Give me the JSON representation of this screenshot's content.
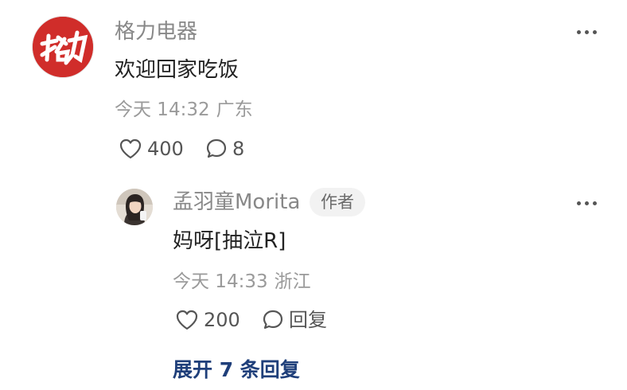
{
  "comment": {
    "author": "格力电器",
    "avatar_logo_text": "格力",
    "text": "欢迎回家吃饭",
    "time": "今天 14:32",
    "location": "广东",
    "like_count": "400",
    "reply_count": "8"
  },
  "reply": {
    "author": "孟羽童Morita",
    "badge": "作者",
    "text": "妈呀[抽泣R]",
    "time": "今天 14:33",
    "location": "浙江",
    "like_count": "200",
    "reply_label": "回复"
  },
  "expand_replies_label": "展开 7 条回复",
  "icons": {
    "more": "more-dots-icon",
    "like": "heart-icon",
    "comment": "comment-bubble-icon"
  },
  "colors": {
    "brand_red": "#d02d2a",
    "link_blue": "#1f3f7a",
    "secondary_text": "#9a9a9a"
  }
}
